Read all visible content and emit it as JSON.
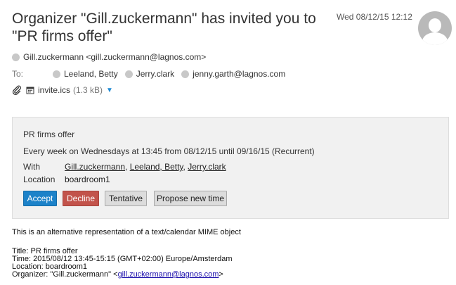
{
  "email": {
    "subject": "Organizer \"Gill.zuckermann\" has invited you to \"PR firms offer\"",
    "date": "Wed 08/12/15 12:12",
    "from": "Gill.zuckermann <gill.zuckermann@lagnos.com>",
    "to_label": "To:",
    "recipients": [
      "Leeland, Betty",
      "Jerry.clark",
      "jenny.garth@lagnos.com"
    ],
    "attachment": {
      "name": "invite.ics",
      "size": "(1.3 kB)",
      "caret": "▼"
    }
  },
  "invite": {
    "title": "PR firms offer",
    "recurrence": "Every week on Wednesdays at 13:45 from 08/12/15 until 09/16/15 (Recurrent)",
    "with_label": "With",
    "attendees": [
      "Gill.zuckermann",
      "Leeland, Betty",
      "Jerry.clark"
    ],
    "separator": ", ",
    "location_label": "Location",
    "location": "boardroom1",
    "buttons": {
      "accept": "Accept",
      "decline": "Decline",
      "tentative": "Tentative",
      "propose": "Propose new time"
    },
    "colors": {
      "accept": "#1c82c9",
      "decline": "#c2534b",
      "neutral": "#dcdcdc"
    }
  },
  "body": {
    "intro": "This is an alternative representation of a text/calendar MIME object",
    "title_line": "Title: PR firms offer",
    "time_line": "Time: 2015/08/12 13:45-15:15 (GMT+02:00) Europe/Amsterdam",
    "location_line": "Location: boardroom1",
    "organizer_prefix": "Organizer: \"Gill.zuckermann\" <",
    "organizer_email": "gill.zuckermann@lagnos.com",
    "organizer_suffix": ">"
  },
  "icons": [
    "avatar-icon",
    "contact-dot-icon",
    "paperclip-icon",
    "calendar-icon",
    "dropdown-caret-icon"
  ]
}
